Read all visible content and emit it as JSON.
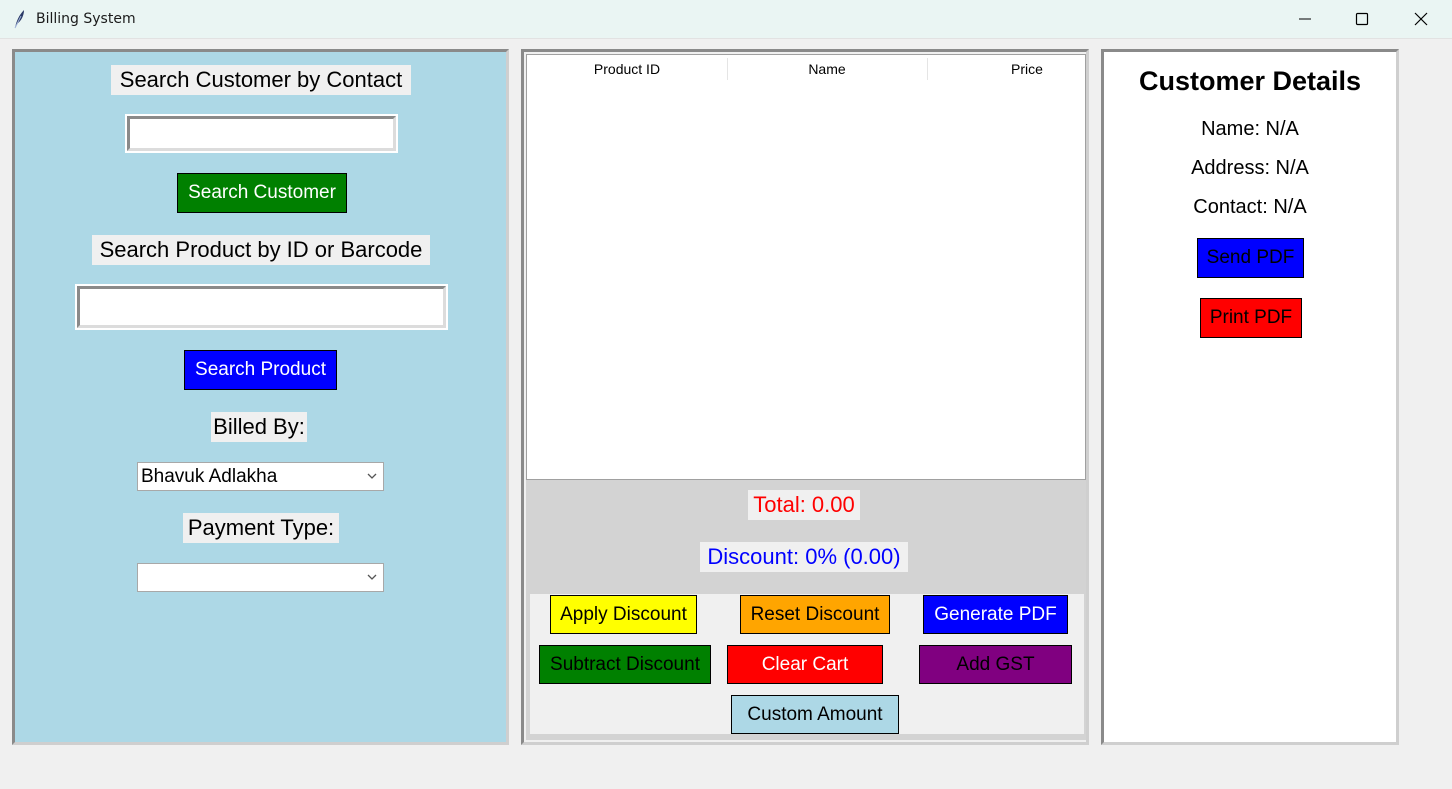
{
  "window": {
    "title": "Billing System"
  },
  "left": {
    "contact_label": "Search Customer by Contact",
    "contact_value": "",
    "search_customer_btn": "Search Customer",
    "product_label": "Search Product by ID or Barcode",
    "product_value": "",
    "search_product_btn": "Search Product",
    "billed_by_label": "Billed By:",
    "billed_by_value": "Bhavuk Adlakha",
    "payment_type_label": "Payment Type:",
    "payment_type_value": ""
  },
  "cart": {
    "columns": [
      "Product ID",
      "Name",
      "Price"
    ],
    "rows": [],
    "total": "Total: 0.00",
    "discount": "Discount: 0% (0.00)"
  },
  "actions": {
    "apply_discount": "Apply Discount",
    "reset_discount": "Reset Discount",
    "generate_pdf": "Generate PDF",
    "subtract_discount": "Subtract Discount",
    "clear_cart": "Clear Cart",
    "add_gst": "Add GST",
    "custom_amount": "Custom Amount"
  },
  "customer": {
    "heading": "Customer Details",
    "name": "Name: N/A",
    "address": "Address: N/A",
    "contact": "Contact: N/A",
    "send_pdf": "Send PDF",
    "print_pdf": "Print PDF"
  },
  "colors": {
    "left_panel_bg": "#add8e6",
    "green": "#008000",
    "blue": "#0000ff",
    "red": "#ff0000",
    "yellow": "#ffff00",
    "orange": "#ffa500",
    "purple": "#800080",
    "light_blue": "#add8e6"
  },
  "icons": {
    "app": "feather-icon",
    "minimize": "minimize-icon",
    "maximize": "maximize-icon",
    "close": "close-icon",
    "dropdown": "chevron-down-icon"
  }
}
